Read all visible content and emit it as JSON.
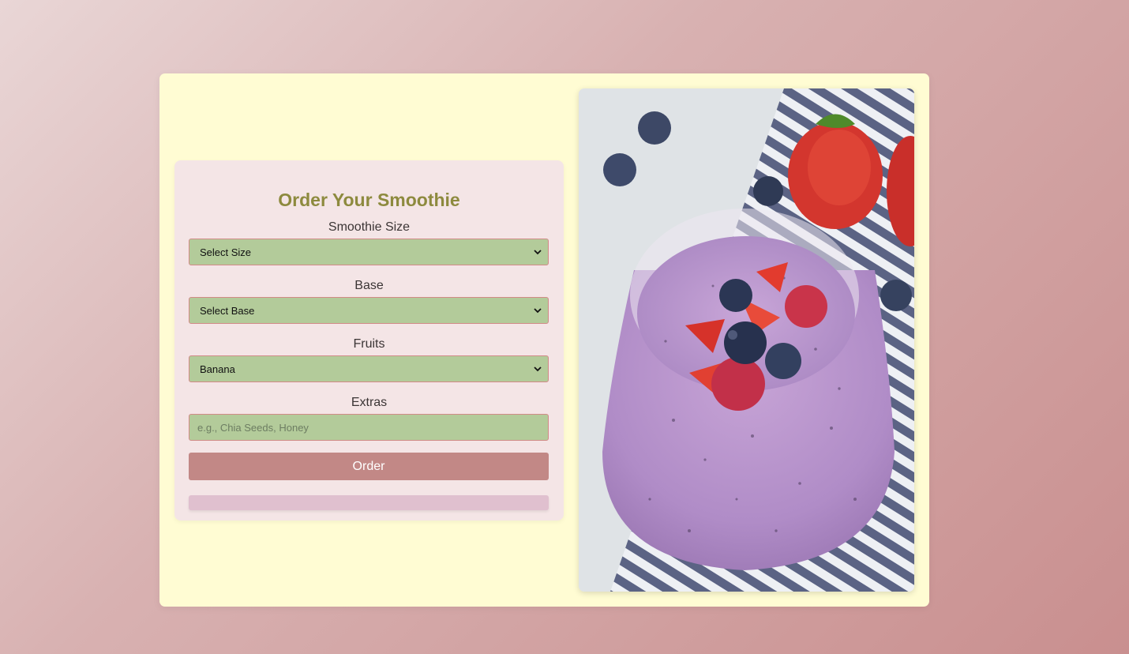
{
  "form": {
    "title": "Order Your Smoothie",
    "size": {
      "label": "Smoothie Size",
      "selected": "Select Size"
    },
    "base": {
      "label": "Base",
      "selected": "Select Base"
    },
    "fruits": {
      "label": "Fruits",
      "selected": "Banana"
    },
    "extras": {
      "label": "Extras",
      "placeholder": "e.g., Chia Seeds, Honey",
      "value": ""
    },
    "order_button": "Order",
    "result": ""
  },
  "colors": {
    "background_gradient_start": "#e9d6d6",
    "background_gradient_end": "#c98f8f",
    "card": "#fffcd3",
    "form_panel": "#f4e5e6",
    "title": "#8d8a3e",
    "field_bg": "#b3cb9a",
    "field_border": "#d18a87",
    "button": "#c28886",
    "result_box": "#e0c0cf"
  },
  "image": {
    "name": "berry-smoothie-photo"
  },
  "icons": {
    "dropdown": "chevron-down-icon"
  }
}
